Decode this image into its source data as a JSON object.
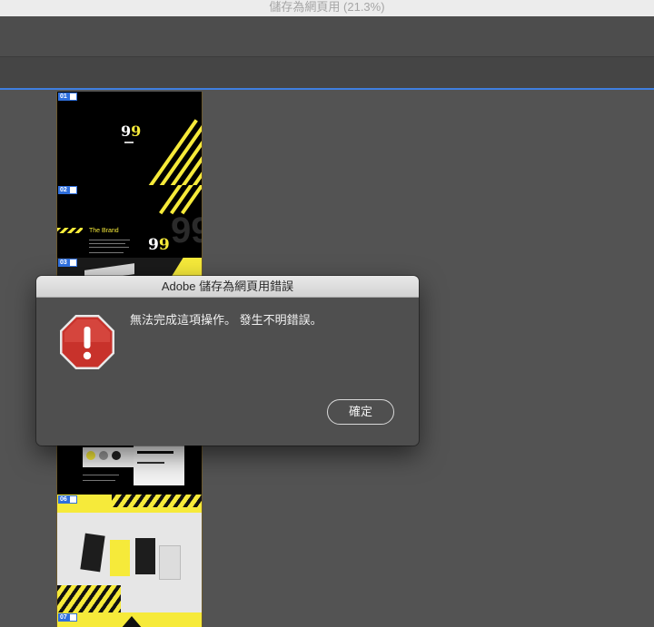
{
  "window": {
    "title": "儲存為網頁用 (21.3%)"
  },
  "artboards": [
    {
      "label": "01"
    },
    {
      "label": "02",
      "heading": "The Brand"
    },
    {
      "label": "03"
    },
    {
      "label": "06"
    },
    {
      "label": "07"
    }
  ],
  "dialog": {
    "title": "Adobe 儲存為網頁用錯誤",
    "message": "無法完成這項操作。 發生不明錯誤。",
    "ok_label": "確定",
    "icon": "stop-sign-icon"
  },
  "colors": {
    "accent_yellow": "#f6ea3a",
    "selection_blue": "#3f7fe0",
    "stop_red": "#c8322b"
  }
}
